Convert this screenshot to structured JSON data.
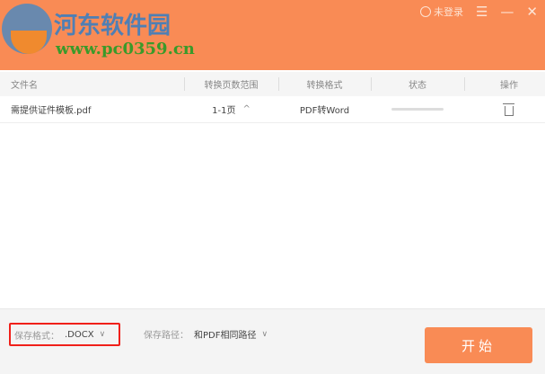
{
  "watermark": {
    "title": "河东软件园",
    "url": "www.pc0359.cn"
  },
  "header": {
    "user_label": "未登录",
    "menu_icon": "menu-icon",
    "minimize_icon": "minimize-icon",
    "close_icon": "close-icon"
  },
  "table": {
    "columns": [
      "文件名",
      "转换页数范围",
      "转换格式",
      "状态",
      "操作"
    ],
    "rows": [
      {
        "filename": "需提供证件模板.pdf",
        "page_range": "1-1页",
        "format": "PDF转Word",
        "progress": 0
      }
    ]
  },
  "footer": {
    "format_label": "保存格式：",
    "format_value": ".DOCX",
    "path_label": "保存路径：",
    "path_value": "和PDF相同路径",
    "start_label": "开始"
  },
  "colors": {
    "accent": "#f98b55",
    "highlight": "#f0201a"
  }
}
